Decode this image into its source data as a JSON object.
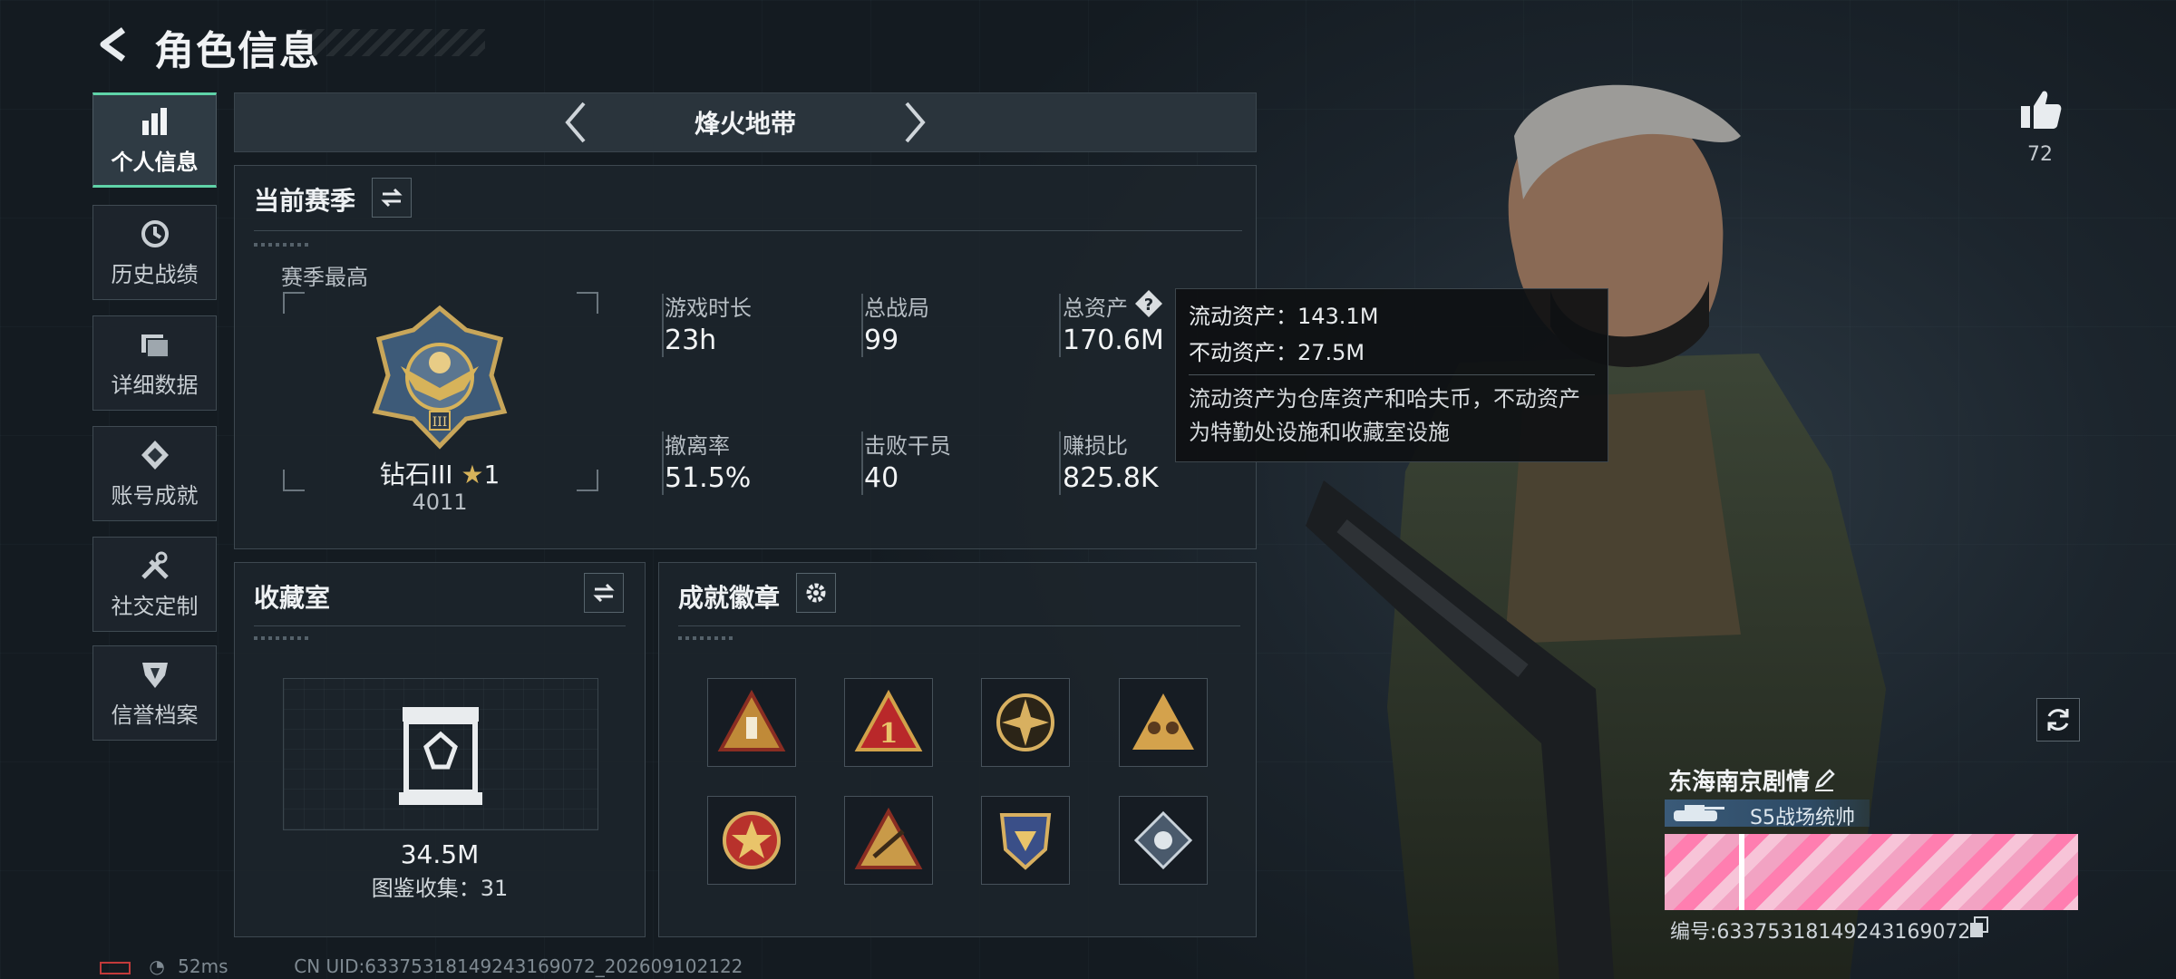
{
  "header": {
    "title": "角色信息"
  },
  "nav": [
    {
      "label": "个人信息",
      "icon": "bar-chart-icon",
      "active": true
    },
    {
      "label": "历史战绩",
      "icon": "history-icon"
    },
    {
      "label": "详细数据",
      "icon": "folder-icon"
    },
    {
      "label": "账号成就",
      "icon": "achievement-icon"
    },
    {
      "label": "社交定制",
      "icon": "tools-icon"
    },
    {
      "label": "信誉档案",
      "icon": "reputation-icon"
    }
  ],
  "mode": {
    "title": "烽火地带"
  },
  "season": {
    "title": "当前赛季",
    "best_label": "赛季最高",
    "rank_name": "钻石III",
    "rank_stars": "1",
    "rank_points": "4011",
    "stats": [
      {
        "label": "游戏时长",
        "value": "23h"
      },
      {
        "label": "总战局",
        "value": "99"
      },
      {
        "label": "总资产",
        "value": "170.6M"
      },
      {
        "label": "撤离率",
        "value": "51.5%"
      },
      {
        "label": "击败干员",
        "value": "40"
      },
      {
        "label": "赚损比",
        "value": "825.8K"
      }
    ]
  },
  "tooltip": {
    "liquid": "流动资产：143.1M",
    "fixed": "不动资产：27.5M",
    "desc_line1": "流动资产为仓库资产和哈夫币，不动资产",
    "desc_line2": "为特勤处设施和收藏室设施"
  },
  "collection": {
    "title": "收藏室",
    "value": "34.5M",
    "count_label": "图鉴收集：31"
  },
  "badges": {
    "title": "成就徽章",
    "items": [
      "badge-1",
      "badge-2",
      "badge-3",
      "badge-4",
      "badge-5",
      "badge-6",
      "badge-7",
      "badge-8"
    ]
  },
  "likes": {
    "count": "72"
  },
  "player": {
    "name": "东海南京剧情",
    "title": "S5战场统帅",
    "id_label": "编号:63375318149243169072"
  },
  "status": {
    "ping": "52ms",
    "uid": "CN UID:63375318149243169072_202609102122"
  },
  "colors": {
    "accent": "#5fd3a8",
    "gold": "#d7b35a",
    "panel": "#1c242b"
  }
}
